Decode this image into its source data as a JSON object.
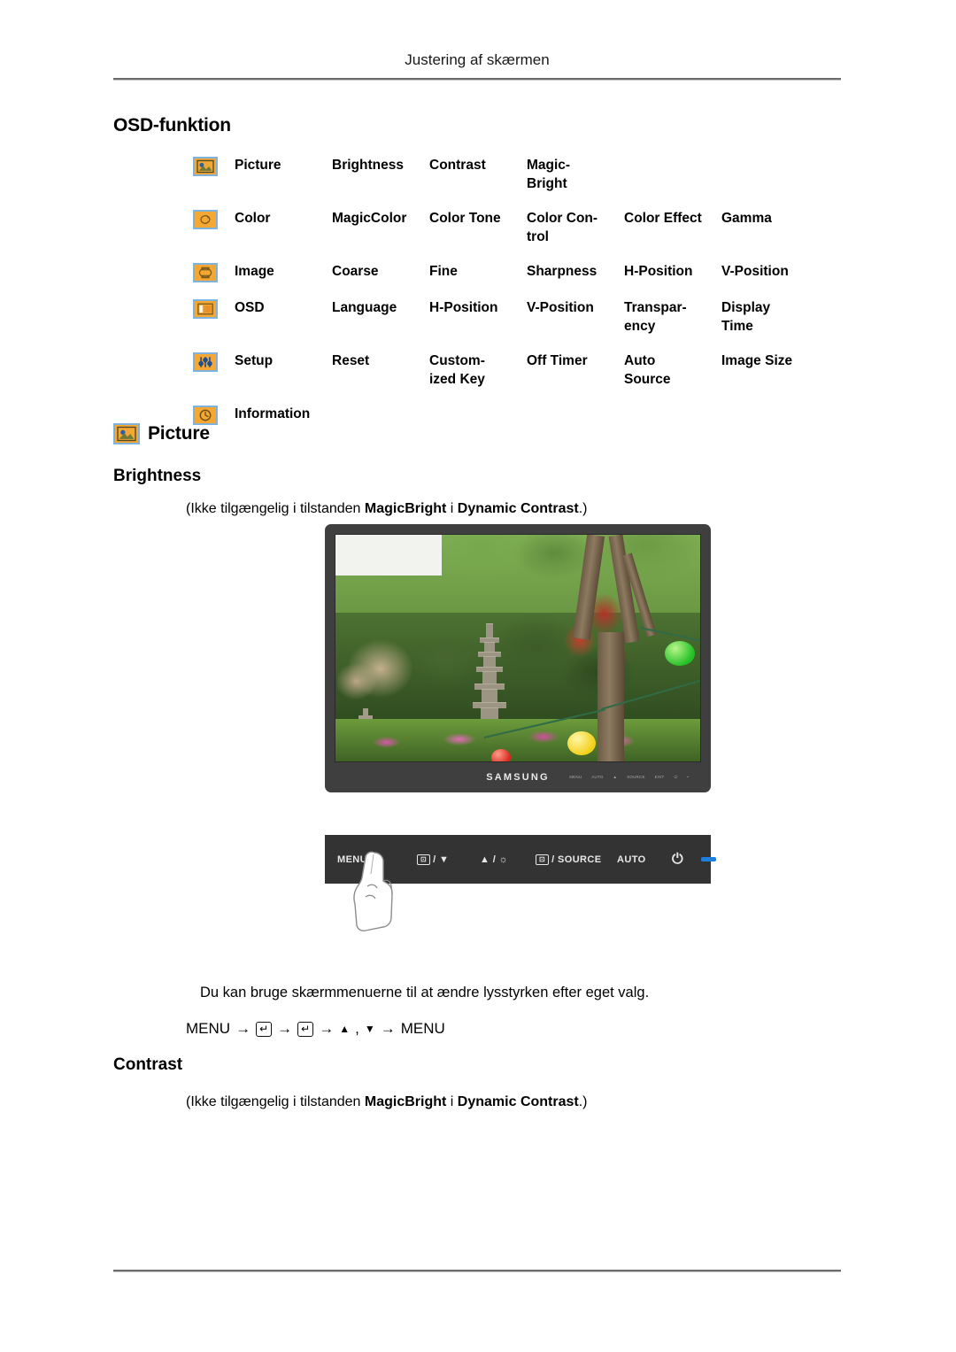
{
  "page": {
    "header_title": "Justering af skærmen"
  },
  "osd_section": {
    "heading": "OSD-funktion",
    "rows": [
      {
        "icon": "picture-icon",
        "label": "Picture",
        "options": [
          "Brightness",
          "Contrast",
          "Magic-\nBright",
          "",
          ""
        ]
      },
      {
        "icon": "color-icon",
        "label": "Color",
        "options": [
          "MagicColor",
          "Color Tone",
          "Color  Con-\ntrol",
          "Color Effect",
          "Gamma"
        ]
      },
      {
        "icon": "image-icon",
        "label": "Image",
        "options": [
          "Coarse",
          "Fine",
          "Sharpness",
          "H-Position",
          "V-Position"
        ]
      },
      {
        "icon": "osd-icon",
        "label": "OSD",
        "options": [
          "Language",
          "H-Position",
          "V-Position",
          "Transpar-\nency",
          "Display\nTime"
        ]
      },
      {
        "icon": "setup-icon",
        "label": "Setup",
        "options": [
          "Reset",
          "Custom-\nized Key",
          "Off Timer",
          "Auto\nSource",
          "Image Size"
        ]
      },
      {
        "icon": "information-icon",
        "label": "Information",
        "options": [
          "",
          "",
          "",
          "",
          ""
        ]
      }
    ]
  },
  "picture_section": {
    "heading": "Picture",
    "brightness": {
      "heading": "Brightness",
      "note_prefix": "(Ikke tilgængelig i tilstanden ",
      "note_bold_1": "MagicBright",
      "note_mid": " i ",
      "note_bold_2": "Dynamic Contrast",
      "note_suffix": ".)",
      "description": "Du kan bruge skærmmenuerne til at ændre lysstyrken efter eget valg.",
      "menu_path": {
        "start": "MENU",
        "arrow": "→",
        "enter_glyph": "↵",
        "up_label": "▲",
        "comma": ",",
        "down_label": "▼",
        "end": "MENU"
      }
    },
    "contrast": {
      "heading": "Contrast",
      "note_prefix": "(Ikke tilgængelig i tilstanden ",
      "note_bold_1": "MagicBright",
      "note_mid": " i ",
      "note_bold_2": "Dynamic Contrast",
      "note_suffix": ".)"
    }
  },
  "monitor_figure": {
    "brand": "SAMSUNG",
    "bezel_keys": [
      "MENU",
      "AUTO",
      "▲",
      "SOURCE",
      "EXIT",
      "⏻",
      "•"
    ]
  },
  "control_panel_figure": {
    "keys": [
      {
        "name": "menu-key",
        "label": "MENU"
      },
      {
        "name": "minus-down-key",
        "glyph": "⊡",
        "label": "/ ▼"
      },
      {
        "name": "up-brightness-key",
        "label": "▲ / ☼"
      },
      {
        "name": "enter-source-key",
        "glyph": "⊡",
        "label": "/ SOURCE"
      },
      {
        "name": "auto-key",
        "label": "AUTO"
      },
      {
        "name": "power-key",
        "label": "⏻"
      },
      {
        "name": "power-led",
        "label": ""
      }
    ]
  },
  "colors": {
    "icon_fill": "#f5a733",
    "icon_border": "#7fb2dc",
    "bezel": "#3f3f3f",
    "control_strip": "#333333",
    "led": "#1f7fe0"
  }
}
